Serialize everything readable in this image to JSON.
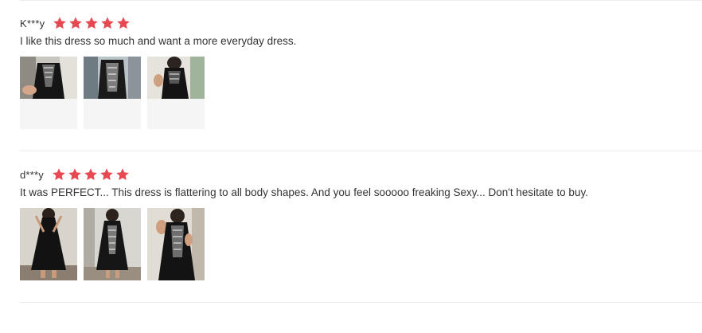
{
  "reviews": [
    {
      "author": "K***y",
      "rating": 5,
      "text": "I like this dress so much and want a more everyday dress.",
      "photos": [
        {
          "icon": "review-photo",
          "style": "short"
        },
        {
          "icon": "review-photo",
          "style": "short"
        },
        {
          "icon": "review-photo",
          "style": "short"
        }
      ]
    },
    {
      "author": "d***y",
      "rating": 5,
      "text": "It was PERFECT... This dress is flattering to all body shapes. And you feel sooooo freaking Sexy... Don't hesitate to buy.",
      "photos": [
        {
          "icon": "review-photo",
          "style": "full"
        },
        {
          "icon": "review-photo",
          "style": "full"
        },
        {
          "icon": "review-photo",
          "style": "full"
        }
      ]
    }
  ],
  "colors": {
    "star": "#e8484f",
    "divider": "#ececec",
    "text": "#333333",
    "photo_bg": "#f5f5f5"
  }
}
